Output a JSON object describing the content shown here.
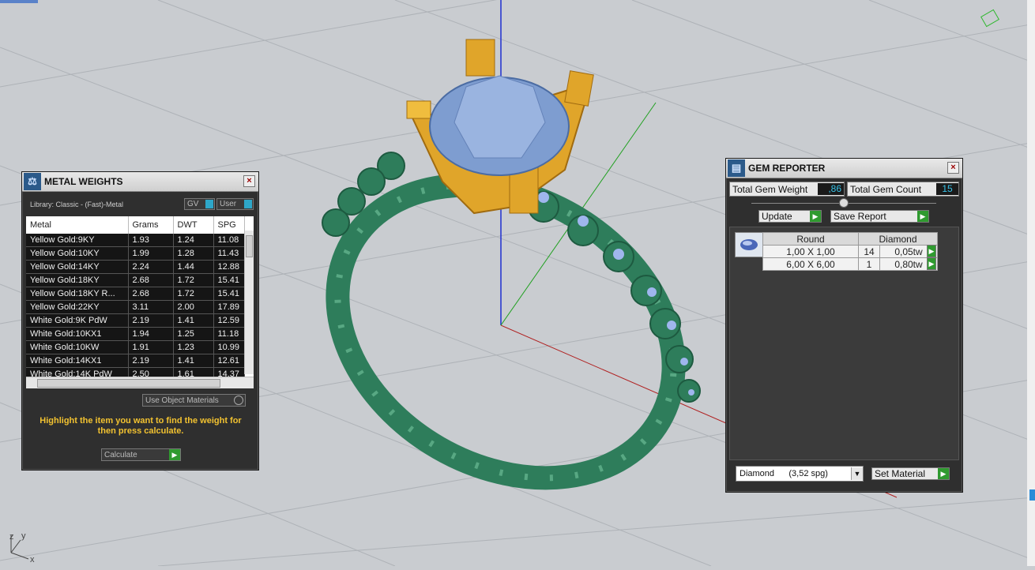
{
  "viewport": {
    "axis_label_z": "z",
    "axis_label_y": "y",
    "axis_label_x": "x"
  },
  "metal_weights": {
    "title": "METAL WEIGHTS",
    "library": "Library: Classic - (Fast)-Metal",
    "gv_label": "GV",
    "user_label": "User",
    "columns": [
      "Metal",
      "Grams",
      "DWT",
      "SPG"
    ],
    "rows": [
      [
        "Yellow Gold:9KY",
        "1.93",
        "1.24",
        "11.08"
      ],
      [
        "Yellow Gold:10KY",
        "1.99",
        "1.28",
        "11.43"
      ],
      [
        "Yellow Gold:14KY",
        "2.24",
        "1.44",
        "12.88"
      ],
      [
        "Yellow Gold:18KY",
        "2.68",
        "1.72",
        "15.41"
      ],
      [
        "Yellow Gold:18KY R...",
        "2.68",
        "1.72",
        "15.41"
      ],
      [
        "Yellow Gold:22KY",
        "3.11",
        "2.00",
        "17.89"
      ],
      [
        "White Gold:9K PdW",
        "2.19",
        "1.41",
        "12.59"
      ],
      [
        "White Gold:10KX1",
        "1.94",
        "1.25",
        "11.18"
      ],
      [
        "White Gold:10KW",
        "1.91",
        "1.23",
        "10.99"
      ],
      [
        "White Gold:14KX1",
        "2.19",
        "1.41",
        "12.61"
      ],
      [
        "White Gold:14K PdW",
        "2.50",
        "1.61",
        "14.37"
      ]
    ],
    "use_object_materials": "Use Object Materials",
    "hint": "Highlight the item you want to find the weight for then press calculate.",
    "calculate_label": "Calculate"
  },
  "gem_reporter": {
    "title": "GEM REPORTER",
    "total_weight_label": "Total Gem Weight",
    "total_weight_value": ",86",
    "total_count_label": "Total Gem Count",
    "total_count_value": "15",
    "update_label": "Update",
    "save_report_label": "Save Report",
    "table_head": [
      "Round",
      "Diamond"
    ],
    "rows": [
      [
        "1,00 X 1,00",
        "14",
        "0,05tw"
      ],
      [
        "6,00 X 6,00",
        "1",
        "0,80tw"
      ]
    ],
    "material_select": "Diamond      (3,52 spg)",
    "set_material_label": "Set Material"
  },
  "colors": {
    "panel_bg": "#2f2f2f",
    "ring_green": "#2e7d5b",
    "prong_gold": "#e0a52a",
    "gem_blue": "#7e9dd0",
    "go_green": "#2f9a2f",
    "value_cyan": "#36c2e8",
    "hint_yellow": "#f2c230"
  }
}
